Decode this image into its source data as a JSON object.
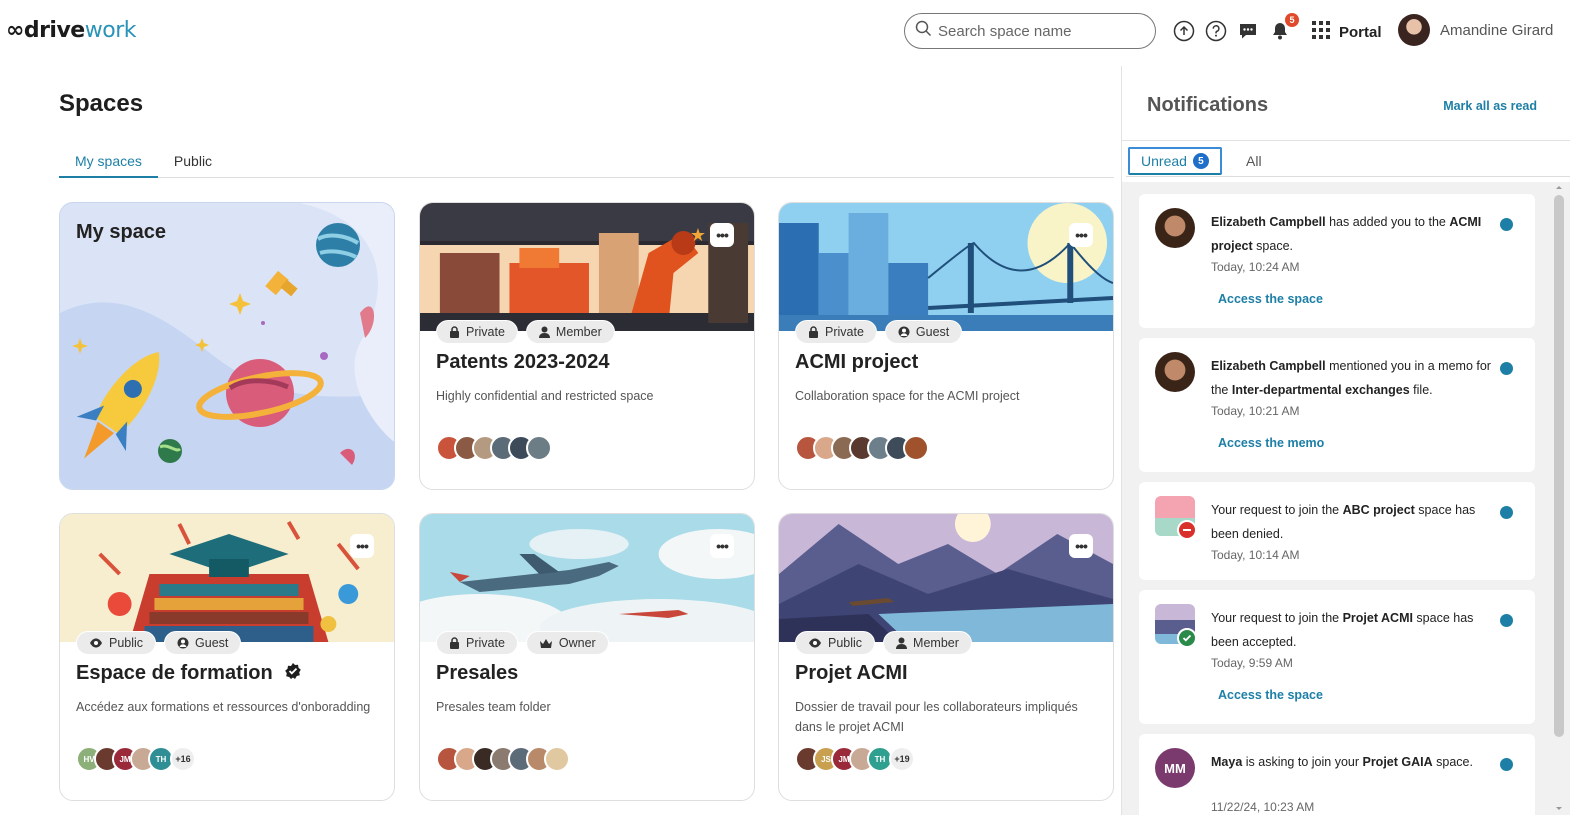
{
  "header": {
    "logo_part1": "∞drive",
    "logo_part2": "work",
    "search_placeholder": "Search space name",
    "icons": [
      "upload-icon",
      "help-icon",
      "chat-icon",
      "bell-icon",
      "apps-grid-icon"
    ],
    "notification_count": "5",
    "portal_label": "Portal",
    "user_name": "Amandine Girard"
  },
  "main": {
    "title": "Spaces",
    "tabs": [
      {
        "label": "My spaces",
        "active": true
      },
      {
        "label": "Public",
        "active": false
      }
    ],
    "my_space_label": "My space",
    "cards": [
      {
        "name": "Patents 2023-2024",
        "description": "Highly confidential and restricted space",
        "tags": [
          "Private",
          "Member"
        ],
        "tag_icons": [
          "lock-icon",
          "person-icon"
        ],
        "favorite": true,
        "avatar_colors": [
          "#c9543b",
          "#8a5a44",
          "#b59a82",
          "#5b6b78",
          "#3c4a5a",
          "#6d7d86"
        ],
        "extra_members": ""
      },
      {
        "name": "ACMI project",
        "description": "Collaboration space for the ACMI project",
        "tags": [
          "Private",
          "Guest"
        ],
        "tag_icons": [
          "lock-icon",
          "guest-icon"
        ],
        "favorite": false,
        "avatar_colors": [
          "#b8553e",
          "#d9a88b",
          "#8a6a52",
          "#5a3a2e",
          "#6e7f8c",
          "#3e4b58",
          "#a0522d"
        ],
        "extra_members": ""
      },
      {
        "name": "Espace de formation",
        "description": "Accédez aux formations et ressources d'onboradding",
        "tags": [
          "Public",
          "Guest"
        ],
        "tag_icons": [
          "eye-icon",
          "guest-icon"
        ],
        "favorite": false,
        "verified": true,
        "avatar_colors": [
          "#8db07a",
          "#6a3a2e",
          "#9a2a3a",
          "#c7a995",
          "#2f8f95"
        ],
        "avatar_initials": [
          "HV",
          "",
          "JM",
          "",
          "TH"
        ],
        "extra_members": "+16"
      },
      {
        "name": "Presales",
        "description": "Presales team folder",
        "tags": [
          "Private",
          "Owner"
        ],
        "tag_icons": [
          "lock-icon",
          "crown-icon"
        ],
        "favorite": false,
        "avatar_colors": [
          "#b8553e",
          "#d9a88b",
          "#3a2a24",
          "#8a7a70",
          "#5b6b78",
          "#b88a6a",
          "#e0c8a0"
        ],
        "extra_members": ""
      },
      {
        "name": "Projet ACMI",
        "description": "Dossier de travail pour les collaborateurs impliqués dans le projet ACMI",
        "tags": [
          "Public",
          "Member"
        ],
        "tag_icons": [
          "eye-icon",
          "person-icon"
        ],
        "favorite": false,
        "avatar_colors": [
          "#6a3a2e",
          "#c9a050",
          "#9a2a3a",
          "#c7a995",
          "#2f9f8f"
        ],
        "avatar_initials": [
          "",
          "JS",
          "JM",
          "",
          "TH"
        ],
        "extra_members": "+19"
      }
    ]
  },
  "notifications": {
    "title": "Notifications",
    "mark_all": "Mark all as read",
    "tab_unread": "Unread",
    "unread_count": "5",
    "tab_all": "All",
    "items": [
      {
        "parts": [
          [
            "b",
            "Elizabeth Campbell"
          ],
          [
            "t",
            " has added you to the "
          ],
          [
            "b",
            "ACMI project"
          ],
          [
            "t",
            " space."
          ]
        ],
        "time": "Today, 10:24 AM",
        "link": "Access the space"
      },
      {
        "parts": [
          [
            "b",
            "Elizabeth Campbell"
          ],
          [
            "t",
            " mentioned you in a memo for the "
          ],
          [
            "b",
            "Inter-departmental exchanges"
          ],
          [
            "t",
            " file."
          ]
        ],
        "time": "Today, 10:21 AM",
        "link": "Access the memo"
      },
      {
        "parts": [
          [
            "t",
            "Your request to join the "
          ],
          [
            "b",
            "ABC project"
          ],
          [
            "t",
            " space has been denied."
          ]
        ],
        "time": "Today, 10:14 AM",
        "link": ""
      },
      {
        "parts": [
          [
            "t",
            "Your request to join the "
          ],
          [
            "b",
            "Projet ACMI"
          ],
          [
            "t",
            " space has been accepted."
          ]
        ],
        "time": "Today, 9:59 AM",
        "link": "Access the space"
      },
      {
        "parts": [
          [
            "b",
            "Maya"
          ],
          [
            "t",
            " is asking to join your "
          ],
          [
            "b",
            "Projet GAIA"
          ],
          [
            "t",
            " space."
          ]
        ],
        "time": "11/22/24, 10:23 AM",
        "link": "",
        "initials": "MM"
      }
    ]
  }
}
